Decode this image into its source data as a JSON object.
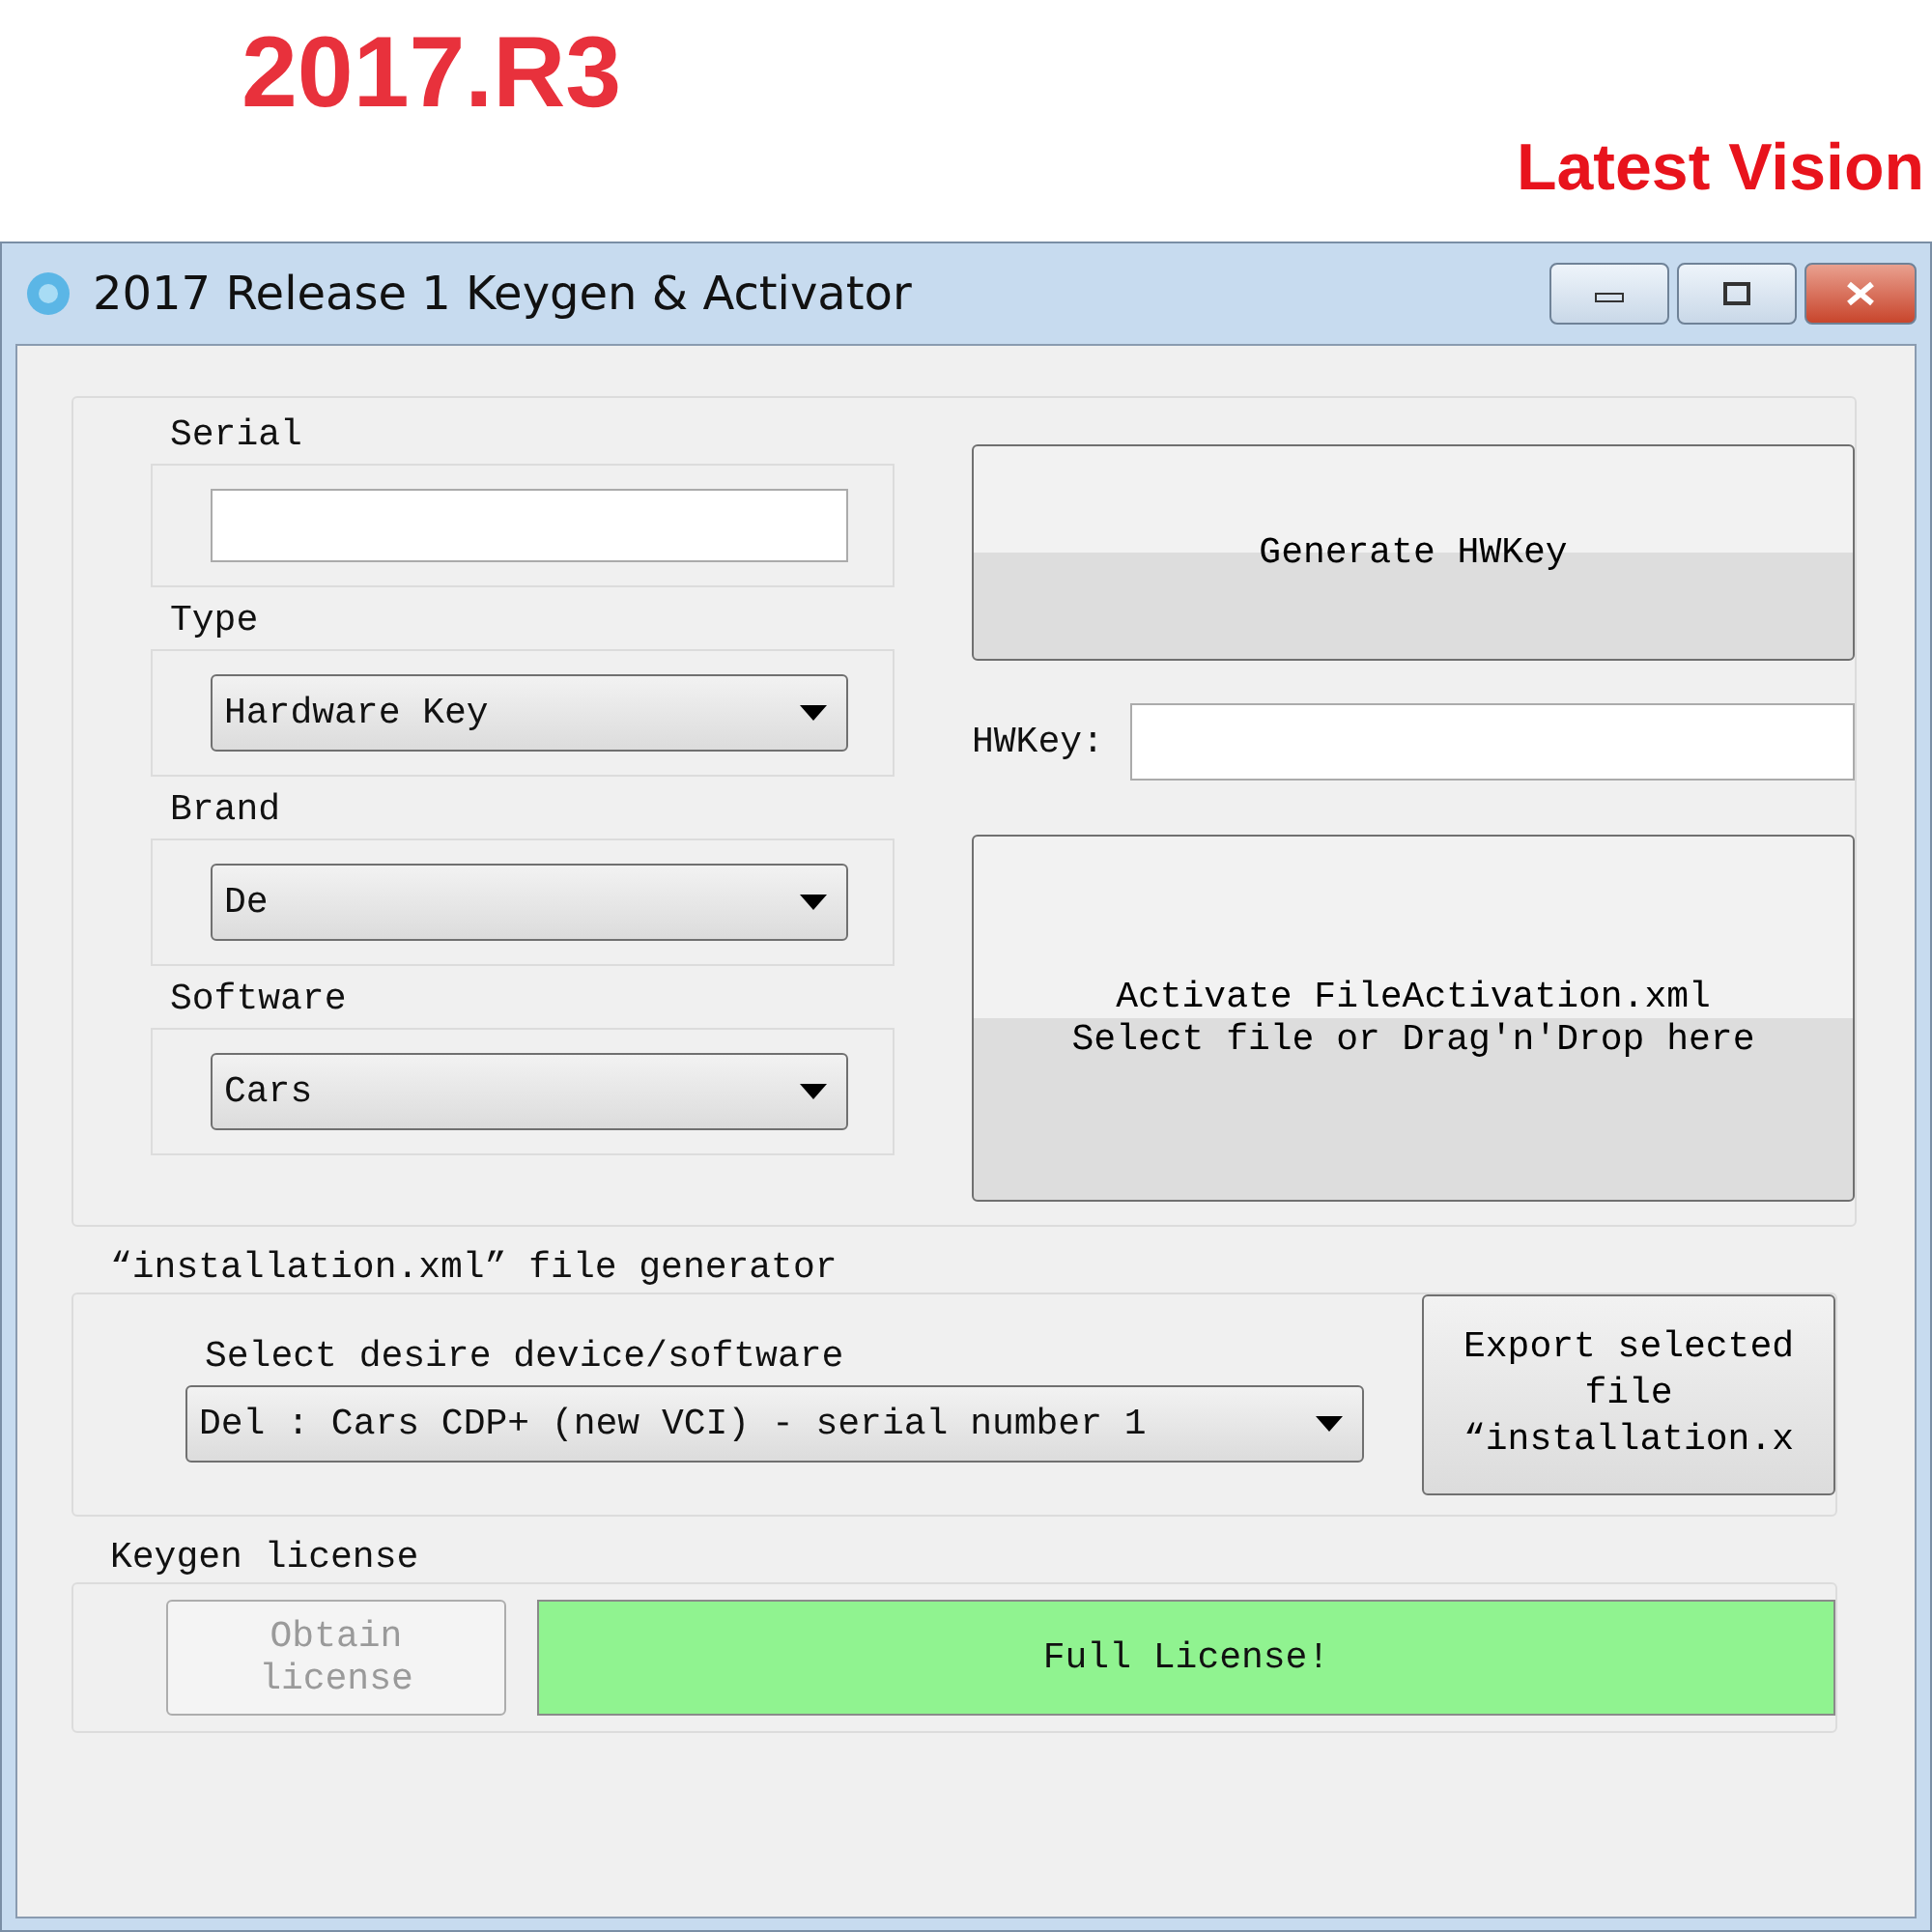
{
  "banner": {
    "title": "2017.R3",
    "subtitle": "Latest Vision"
  },
  "window": {
    "title": "2017 Release 1 Keygen & Activator"
  },
  "fields": [
    {
      "kind": "input",
      "label": "Serial"
    },
    {
      "kind": "select",
      "label": "Type",
      "value": "Hardware Key"
    },
    {
      "kind": "select",
      "label": "Brand",
      "value": "De"
    },
    {
      "kind": "select",
      "label": "Software",
      "value": "Cars"
    }
  ],
  "generate_button": "Generate HWKey",
  "hwkey": {
    "label": "HWKey:"
  },
  "activate_button": [
    "Activate FileActivation.xml",
    "Select file or Drag'n'Drop here"
  ],
  "installation": {
    "title": "“installation.xml” file generator",
    "label": "Select desire device/software",
    "value": "Del : Cars CDP+ (new VCI) - serial number 1",
    "export_button": [
      "Export selected",
      "file",
      "“installation.x"
    ]
  },
  "license": {
    "title": "Keygen license",
    "obtain_button": {
      "lines": [
        "Obtain",
        "license"
      ],
      "disabled": true
    },
    "status": "Full License!"
  }
}
